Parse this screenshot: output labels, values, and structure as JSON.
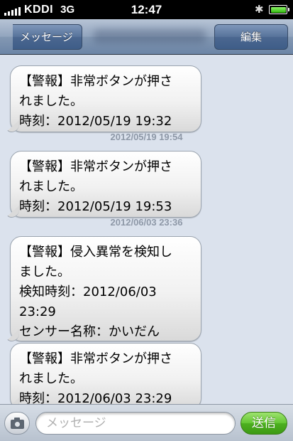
{
  "status_bar": {
    "carrier": "KDDI",
    "network": "3G",
    "time": "12:47",
    "bluetooth_icon": "bluetooth-icon",
    "battery_icon": "battery-icon",
    "signal_icon": "signal-bars-icon"
  },
  "nav_bar": {
    "back_label": "メッセージ",
    "edit_label": "編集"
  },
  "messages": [
    {
      "lines": [
        "【警報】非常ボタンが押さ",
        "れました。",
        "時刻：2012/05/19 19:32"
      ]
    },
    {
      "timestamp": "2012/05/19 19:54",
      "lines": [
        "【警報】非常ボタンが押さ",
        "れました。",
        "時刻：2012/05/19 19:53"
      ]
    },
    {
      "timestamp": "2012/06/03 23:36",
      "lines": [
        "【警報】侵入異常を検知し",
        "ました。",
        "検知時刻：2012/06/03",
        "23:29",
        "センサー名称：かいだん"
      ]
    },
    {
      "lines": [
        "【警報】非常ボタンが押さ",
        "れました。",
        "時刻：2012/06/03 23:29"
      ]
    }
  ],
  "input_bar": {
    "placeholder": "メッセージ",
    "send_label": "送信",
    "camera_icon": "camera-icon"
  },
  "colors": {
    "background": "#dbe2ed",
    "nav_accent": "#56729a",
    "send_green": "#4db020",
    "timestamp_gray": "#8e98a7"
  }
}
